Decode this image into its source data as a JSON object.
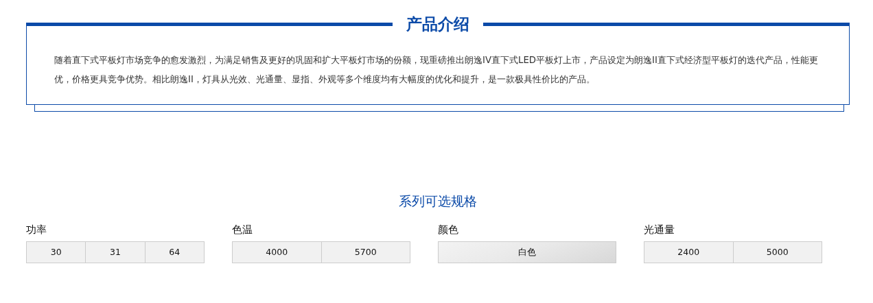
{
  "intro": {
    "title": "产品介绍",
    "text": "随着直下式平板灯市场竞争的愈发激烈，为满足销售及更好的巩固和扩大平板灯市场的份额，现重磅推出朗逸IV直下式LED平板灯上市，产品设定为朗逸II直下式经济型平板灯的迭代产品，性能更优，价格更具竞争优势。相比朗逸II，灯具从光效、光通量、显指、外观等多个维度均有大幅度的优化和提升，是一款极具性价比的产品。"
  },
  "specs_title": "系列可选规格",
  "spec_groups": [
    {
      "label": "功率",
      "options": [
        {
          "label": "30",
          "selected": false
        },
        {
          "label": "31",
          "selected": false
        },
        {
          "label": "64",
          "selected": false
        }
      ]
    },
    {
      "label": "色温",
      "options": [
        {
          "label": "4000",
          "selected": false
        },
        {
          "label": "5700",
          "selected": false
        }
      ]
    },
    {
      "label": "颜色",
      "options": [
        {
          "label": "白色",
          "selected": true
        }
      ]
    },
    {
      "label": "光通量",
      "options": [
        {
          "label": "2400",
          "selected": false
        },
        {
          "label": "5000",
          "selected": false
        }
      ]
    }
  ]
}
